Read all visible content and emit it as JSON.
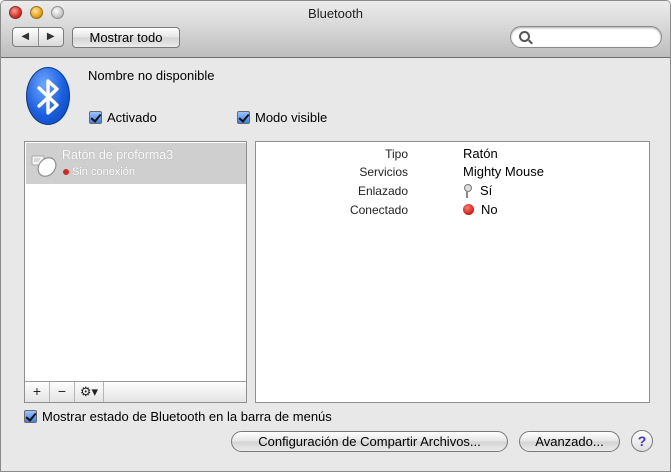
{
  "window": {
    "title": "Bluetooth"
  },
  "toolbar": {
    "back_label": "◀",
    "forward_label": "▶",
    "show_all_label": "Mostrar todo",
    "search": {
      "value": "",
      "placeholder": ""
    }
  },
  "header": {
    "device_name": "Nombre no disponible",
    "on_label": "Activado",
    "on_checked": true,
    "discoverable_label": "Modo visible",
    "discoverable_checked": true
  },
  "devices": [
    {
      "name": "Ratón de proforma3",
      "status": "Sin conexión",
      "status_color": "#d8261d",
      "icon": "mouse-icon"
    }
  ],
  "list_actions": {
    "add": "+",
    "remove": "−",
    "gear": "⚙▾"
  },
  "details": {
    "rows": [
      {
        "label": "Tipo",
        "value": "Ratón"
      },
      {
        "label": "Servicios",
        "value": "Mighty Mouse"
      },
      {
        "label": "Enlazado",
        "value": "Sí",
        "icon": "key-icon"
      },
      {
        "label": "Conectado",
        "value": "No",
        "icon": "red-status-icon"
      }
    ]
  },
  "footer": {
    "menubar_label": "Mostrar estado de Bluetooth en la barra de menús",
    "menubar_checked": true,
    "sharing_button": "Configuración de Compartir Archivos...",
    "advanced_button": "Avanzado...",
    "help_label": "?"
  },
  "colors": {
    "accent": "#1a5fe0",
    "status_red": "#d8261d",
    "selection": "#cfcfcf"
  }
}
